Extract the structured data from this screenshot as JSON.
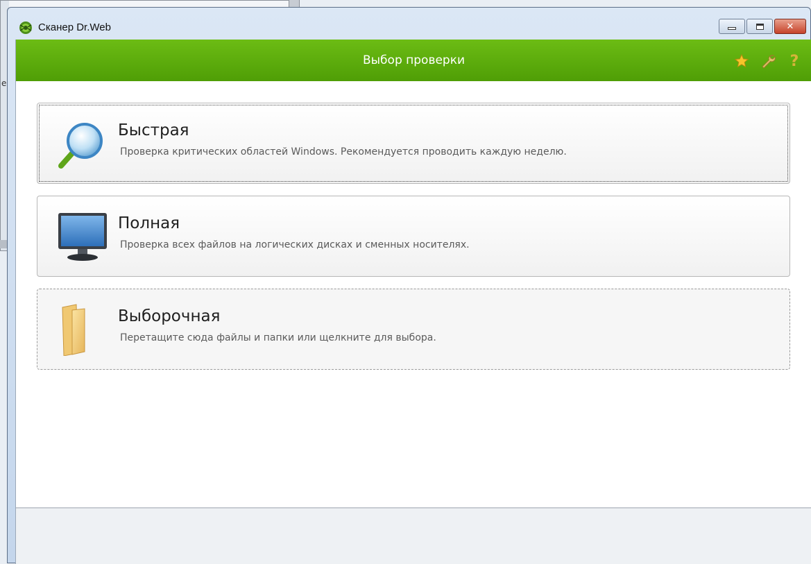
{
  "background": {
    "partial_char": "е"
  },
  "window": {
    "title": "Сканер Dr.Web",
    "controls": {
      "minimize_icon": "minimize-icon",
      "maximize_icon": "maximize-icon",
      "close_icon": "close-icon"
    }
  },
  "header": {
    "title": "Выбор проверки",
    "accent_color": "#5aa80b",
    "icons": [
      "star-icon",
      "wrench-icon",
      "help-icon"
    ],
    "help_glyph": "?"
  },
  "scan_options": [
    {
      "icon": "magnifier-icon",
      "title": "Быстрая",
      "description": "Проверка критических областей Windows. Рекомендуется проводить каждую неделю."
    },
    {
      "icon": "monitor-icon",
      "title": "Полная",
      "description": "Проверка всех файлов на логических дисках и сменных носителях."
    },
    {
      "icon": "folder-icon",
      "title": "Выборочная",
      "description": "Перетащите сюда файлы и папки или щелкните для выбора."
    }
  ]
}
